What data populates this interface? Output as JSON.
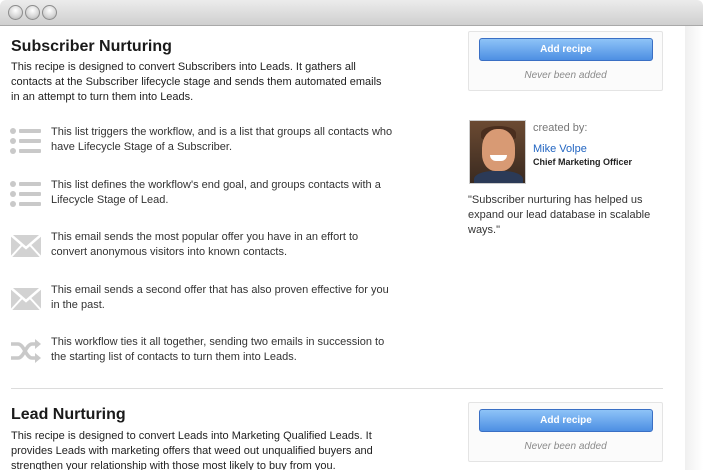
{
  "window": {
    "controls": [
      "close",
      "minimize",
      "maximize"
    ]
  },
  "recipes": [
    {
      "title": "Subscriber Nurturing",
      "description": "This recipe is designed to convert Subscribers into Leads. It gathers all contacts at the Subscriber lifecycle stage and sends them automated emails in an attempt to turn them into Leads.",
      "add_label": "Add recipe",
      "status": "Never been added",
      "steps": [
        {
          "icon": "list-icon",
          "text": "This list triggers the workflow, and is a list that groups all contacts who have Lifecycle Stage of a Subscriber."
        },
        {
          "icon": "list-icon",
          "text": "This list defines the workflow's end goal, and groups contacts with a Lifecycle Stage of Lead."
        },
        {
          "icon": "envelope-icon",
          "text": "This email sends the most popular offer you have in an effort to convert anonymous visitors into known contacts."
        },
        {
          "icon": "envelope-icon",
          "text": "This email sends a second offer that has also proven effective for you in the past."
        },
        {
          "icon": "shuffle-icon",
          "text": "This workflow ties it all together, sending two emails in succession to the starting list of contacts to turn them into Leads."
        }
      ],
      "author": {
        "created_by": "created by:",
        "name": "Mike Volpe",
        "role": "Chief Marketing Officer",
        "quote": "\"Subscriber nurturing has helped us expand our lead database in scalable ways.\""
      }
    },
    {
      "title": "Lead Nurturing",
      "description": "This recipe is designed to convert Leads into Marketing Qualified Leads. It provides Leads with marketing offers that weed out unqualified buyers and strengthen your relationship with those most likely to buy from you.",
      "add_label": "Add recipe",
      "status": "Never been added"
    }
  ],
  "colors": {
    "button": "#4d8fe3",
    "link": "#2366c2",
    "icon": "#c9c9c9"
  }
}
